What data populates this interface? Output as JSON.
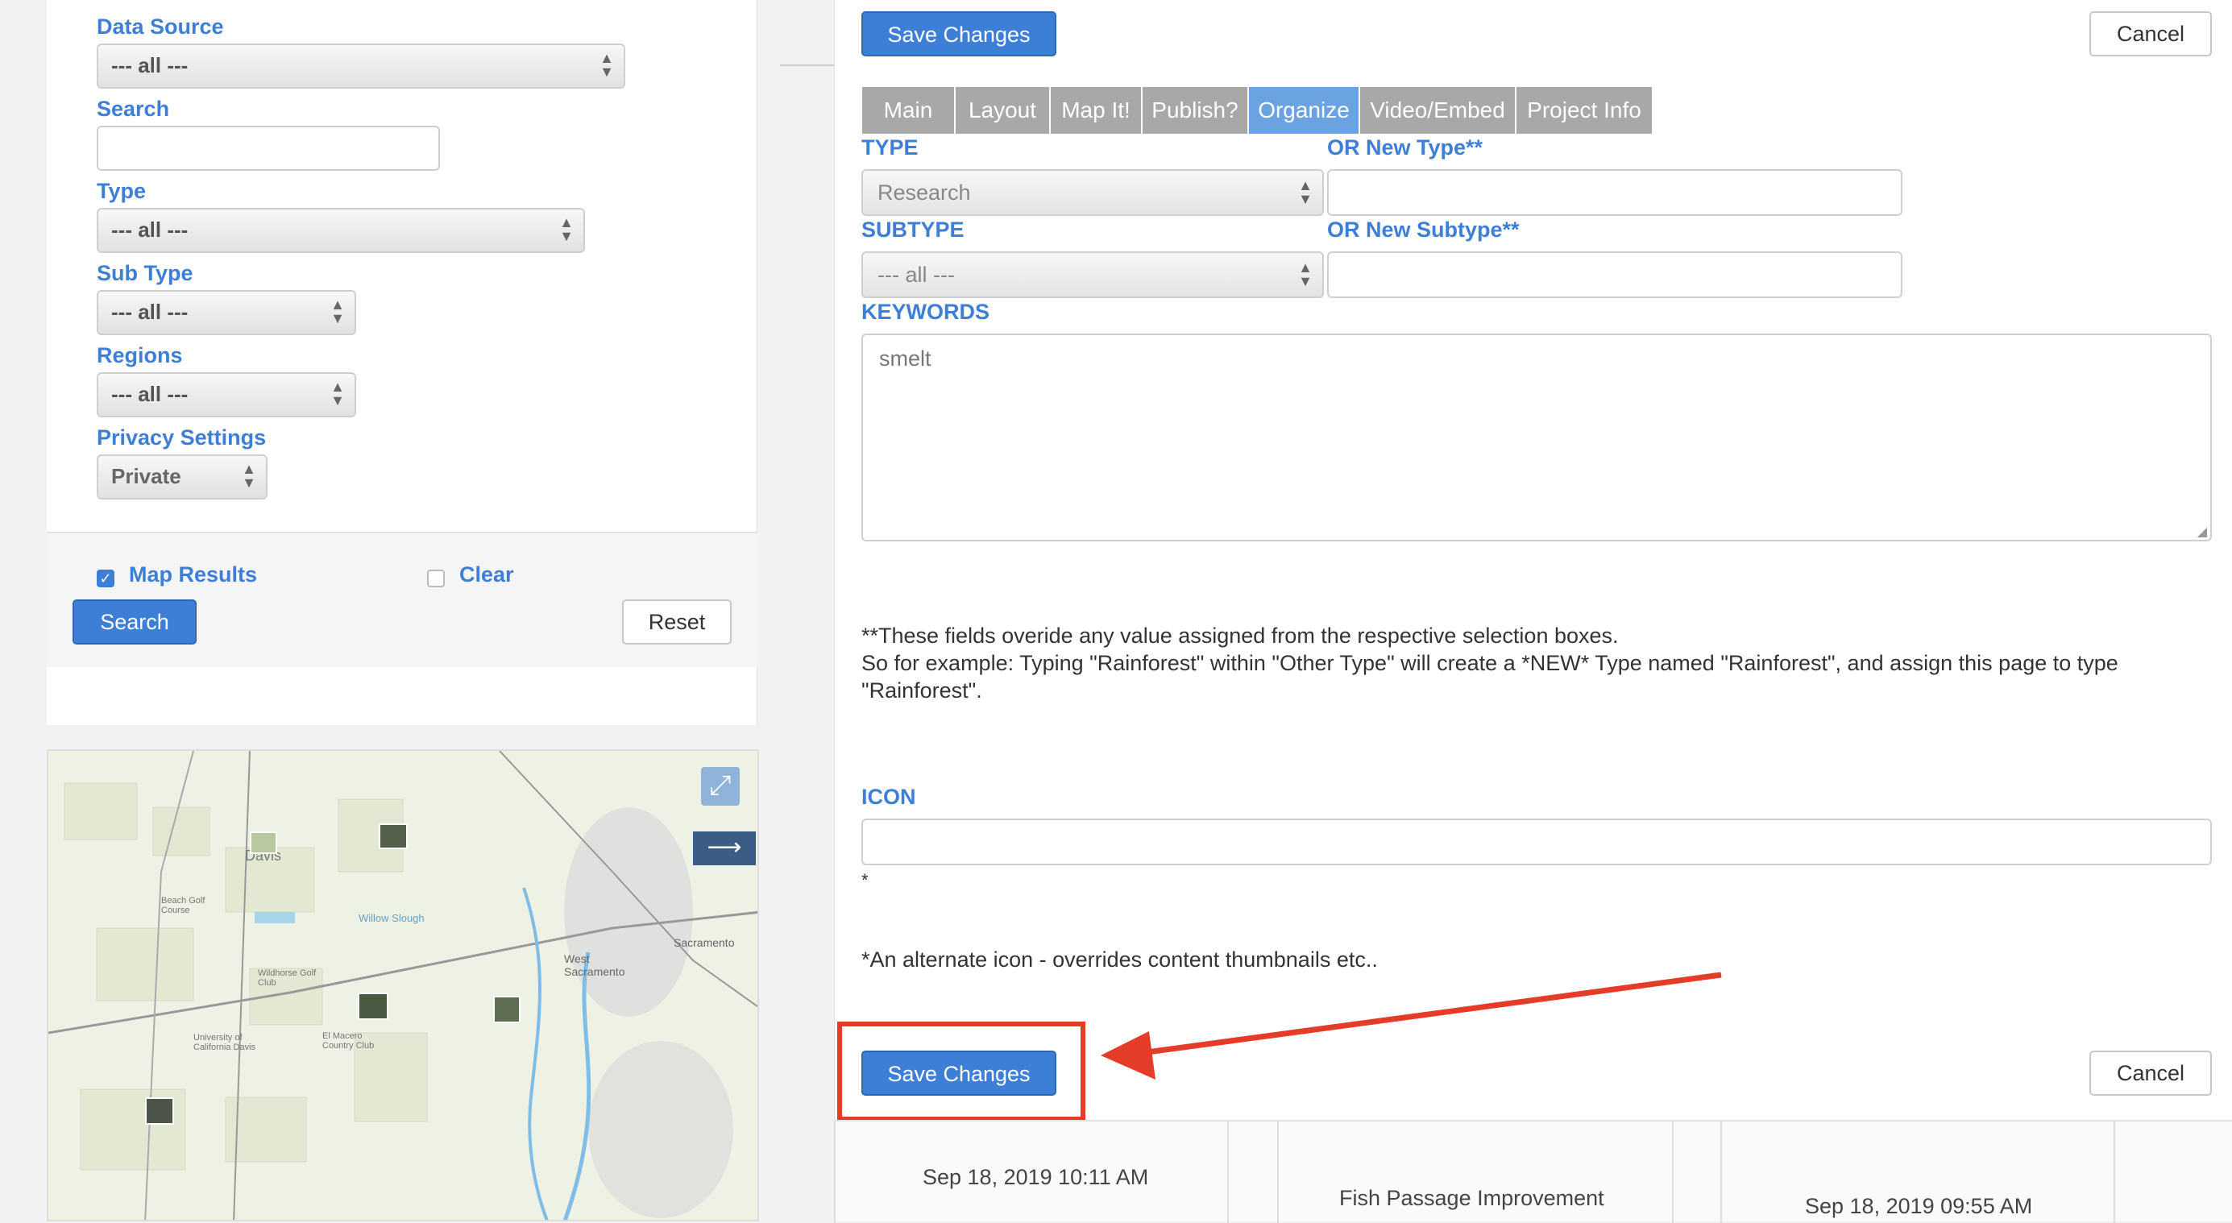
{
  "filters": {
    "data_source": {
      "label": "Data Source",
      "value": "--- all ---"
    },
    "search": {
      "label": "Search",
      "value": ""
    },
    "type": {
      "label": "Type",
      "value": "--- all ---"
    },
    "sub_type": {
      "label": "Sub Type",
      "value": "--- all ---"
    },
    "regions": {
      "label": "Regions",
      "value": "--- all ---"
    },
    "privacy": {
      "label": "Privacy Settings",
      "value": "Private"
    },
    "map_results": {
      "label": "Map Results",
      "checked": true
    },
    "clear": {
      "label": "Clear",
      "checked": false
    },
    "search_button": "Search",
    "reset_button": "Reset"
  },
  "map": {
    "labels": [
      "Davis",
      "West Sacramento",
      "Sacramento",
      "Willow Slough",
      "University of California Davis",
      "El Macero Country Club",
      "Wildhorse Golf Club",
      "Beach Golf Course"
    ],
    "expand_icon": "expand-arrows-icon",
    "arrow_icon": "arrow-right-icon"
  },
  "editor": {
    "save_top": "Save Changes",
    "cancel_top": "Cancel",
    "tabs": [
      "Main",
      "Layout",
      "Map It!",
      "Publish?",
      "Organize",
      "Video/Embed",
      "Project Info"
    ],
    "active_tab": "Organize",
    "type_label": "TYPE",
    "type_value": "Research",
    "new_type_label": "OR New Type**",
    "new_type_value": "",
    "subtype_label": "SUBTYPE",
    "subtype_value": "--- all ---",
    "new_subtype_label": "OR New Subtype**",
    "new_subtype_value": "",
    "keywords_label": "KEYWORDS",
    "keywords_value": "smelt",
    "note_line1": "**These fields overide any value assigned from the respective selection boxes.",
    "note_line2": "So for example: Typing \"Rainforest\" within \"Other Type\" will create a *NEW* Type named \"Rainforest\", and assign this page to type",
    "note_line3": "\"Rainforest\".",
    "icon_label": "ICON",
    "icon_value": "",
    "icon_star": "*",
    "icon_note": "*An alternate icon - overrides content thumbnails etc..",
    "save_bottom": "Save Changes",
    "cancel_bottom": "Cancel",
    "highlight_color": "#e53c2a"
  },
  "table_strip": {
    "date1": "Sep 18, 2019 10:11 AM",
    "title2": "Fish Passage Improvement",
    "date3": "Sep 18, 2019 09:55 AM"
  }
}
